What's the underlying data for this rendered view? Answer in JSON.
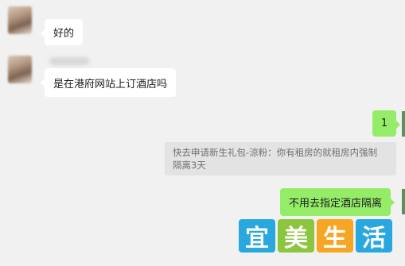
{
  "chat": {
    "messages": [
      {
        "side": "left",
        "text": "好的"
      },
      {
        "side": "left",
        "text": "是在港府网站上订酒店吗"
      },
      {
        "side": "right",
        "text": "1"
      },
      {
        "side": "right",
        "text": "不用去指定酒店隔离"
      }
    ],
    "quote": {
      "line1": "快去申请新生礼包-涼粉：你有租房的就租房内强制",
      "line2": "隔离3天"
    }
  },
  "watermark": {
    "chars": [
      "宜",
      "美",
      "生",
      "活"
    ],
    "colors": [
      "#29a8e0",
      "#8cc63f",
      "#f6a623",
      "#29a8e0"
    ]
  },
  "colors": {
    "background": "#f1f1f1",
    "bubble_self": "#95ec69",
    "bubble_other": "#ffffff"
  }
}
